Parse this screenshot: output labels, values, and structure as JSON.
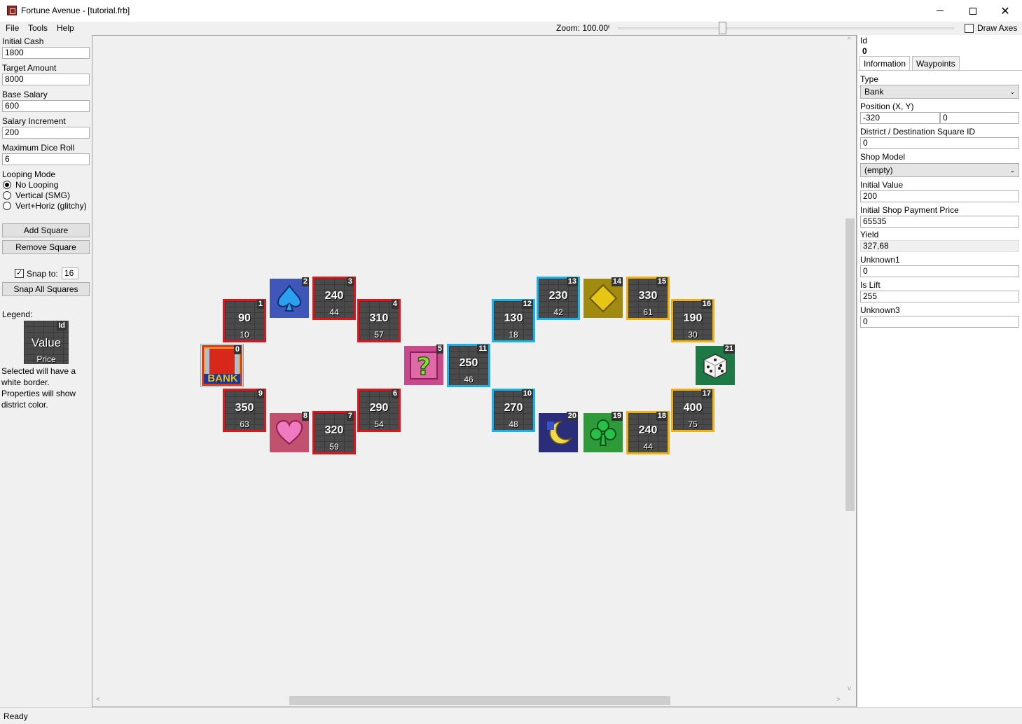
{
  "window": {
    "title": "Fortune Avenue - [tutorial.frb]",
    "minimize_glyph": "",
    "close_glyph": "✕"
  },
  "menu": {
    "items": [
      "File",
      "Tools",
      "Help"
    ],
    "zoom_label": "Zoom: 100.00%",
    "zoom_level": 0.31,
    "draw_axes_label": "Draw Axes",
    "draw_axes_checked": false
  },
  "left_panel": {
    "initial_cash": {
      "label": "Initial Cash",
      "value": "1800"
    },
    "target_amount": {
      "label": "Target Amount",
      "value": "8000"
    },
    "base_salary": {
      "label": "Base Salary",
      "value": "600"
    },
    "salary_increment": {
      "label": "Salary Increment",
      "value": "200"
    },
    "max_dice_roll": {
      "label": "Maximum Dice Roll",
      "value": "6"
    },
    "looping_mode": {
      "label": "Looping Mode",
      "options": [
        "No Looping",
        "Vertical (SMG)",
        "Vert+Horiz (glitchy)"
      ],
      "selected": "No Looping"
    },
    "add_square_label": "Add Square",
    "remove_square_label": "Remove Square",
    "snap_label": "Snap to:",
    "snap_value": "16",
    "snap_checked": true,
    "snap_all_label": "Snap All Squares",
    "legend": {
      "label": "Legend:",
      "id_text": "Id",
      "value_text": "Value",
      "price_text": "Price",
      "desc_lines": [
        "Selected will have a",
        "white border.",
        "Properties will show",
        "district color."
      ]
    }
  },
  "board": {
    "squares": [
      {
        "id": "0",
        "kind": "bank",
        "district": "selected",
        "icon": "bank-icon",
        "text": "BANK"
      },
      {
        "id": "1",
        "kind": "property",
        "district": "red",
        "value": "90",
        "price": "10"
      },
      {
        "id": "2",
        "kind": "suit",
        "district": "none",
        "icon": "spade-icon"
      },
      {
        "id": "3",
        "kind": "property",
        "district": "red",
        "value": "240",
        "price": "44"
      },
      {
        "id": "4",
        "kind": "property",
        "district": "red",
        "value": "310",
        "price": "57"
      },
      {
        "id": "5",
        "kind": "chance",
        "district": "none",
        "icon": "question-icon"
      },
      {
        "id": "6",
        "kind": "property",
        "district": "red",
        "value": "290",
        "price": "54"
      },
      {
        "id": "7",
        "kind": "property",
        "district": "red",
        "value": "320",
        "price": "59"
      },
      {
        "id": "8",
        "kind": "suit",
        "district": "none",
        "icon": "heart-icon"
      },
      {
        "id": "9",
        "kind": "property",
        "district": "red",
        "value": "350",
        "price": "63"
      },
      {
        "id": "10",
        "kind": "property",
        "district": "blue",
        "value": "270",
        "price": "48"
      },
      {
        "id": "11",
        "kind": "property",
        "district": "blue",
        "value": "250",
        "price": "46"
      },
      {
        "id": "12",
        "kind": "property",
        "district": "blue",
        "value": "130",
        "price": "18"
      },
      {
        "id": "13",
        "kind": "property",
        "district": "blue",
        "value": "230",
        "price": "42"
      },
      {
        "id": "14",
        "kind": "suit",
        "district": "none",
        "icon": "diamond-icon"
      },
      {
        "id": "15",
        "kind": "property",
        "district": "yellow",
        "value": "330",
        "price": "61"
      },
      {
        "id": "16",
        "kind": "property",
        "district": "yellow",
        "value": "190",
        "price": "30"
      },
      {
        "id": "17",
        "kind": "property",
        "district": "yellow",
        "value": "400",
        "price": "75"
      },
      {
        "id": "18",
        "kind": "property",
        "district": "yellow",
        "value": "240",
        "price": "44"
      },
      {
        "id": "19",
        "kind": "suit",
        "district": "none",
        "icon": "club-icon"
      },
      {
        "id": "20",
        "kind": "special",
        "district": "none",
        "icon": "moon-icon"
      },
      {
        "id": "21",
        "kind": "special",
        "district": "none",
        "icon": "dice-icon"
      }
    ]
  },
  "right_panel": {
    "id_label": "Id",
    "id_value": "0",
    "tabs": [
      "Information",
      "Waypoints"
    ],
    "active_tab": "Information",
    "type": {
      "label": "Type",
      "value": "Bank"
    },
    "position": {
      "label": "Position (X, Y)",
      "x": "-320",
      "y": "0"
    },
    "district": {
      "label": "District / Destination Square ID",
      "value": "0"
    },
    "shop_model": {
      "label": "Shop Model",
      "value": "(empty)"
    },
    "initial_value": {
      "label": "Initial Value",
      "value": "200"
    },
    "initial_shop_payment": {
      "label": "Initial Shop Payment Price",
      "value": "65535"
    },
    "yield": {
      "label": "Yield",
      "value": "327,68"
    },
    "unknown1": {
      "label": "Unknown1",
      "value": "0"
    },
    "is_lift": {
      "label": "Is Lift",
      "value": "255"
    },
    "unknown3": {
      "label": "Unknown3",
      "value": "0"
    }
  },
  "status": {
    "text": "Ready"
  },
  "colors": {
    "red_district": "#e0141a",
    "blue_district": "#19b0ec",
    "yellow_district": "#f0b010",
    "selected_border": "#ffffff"
  }
}
